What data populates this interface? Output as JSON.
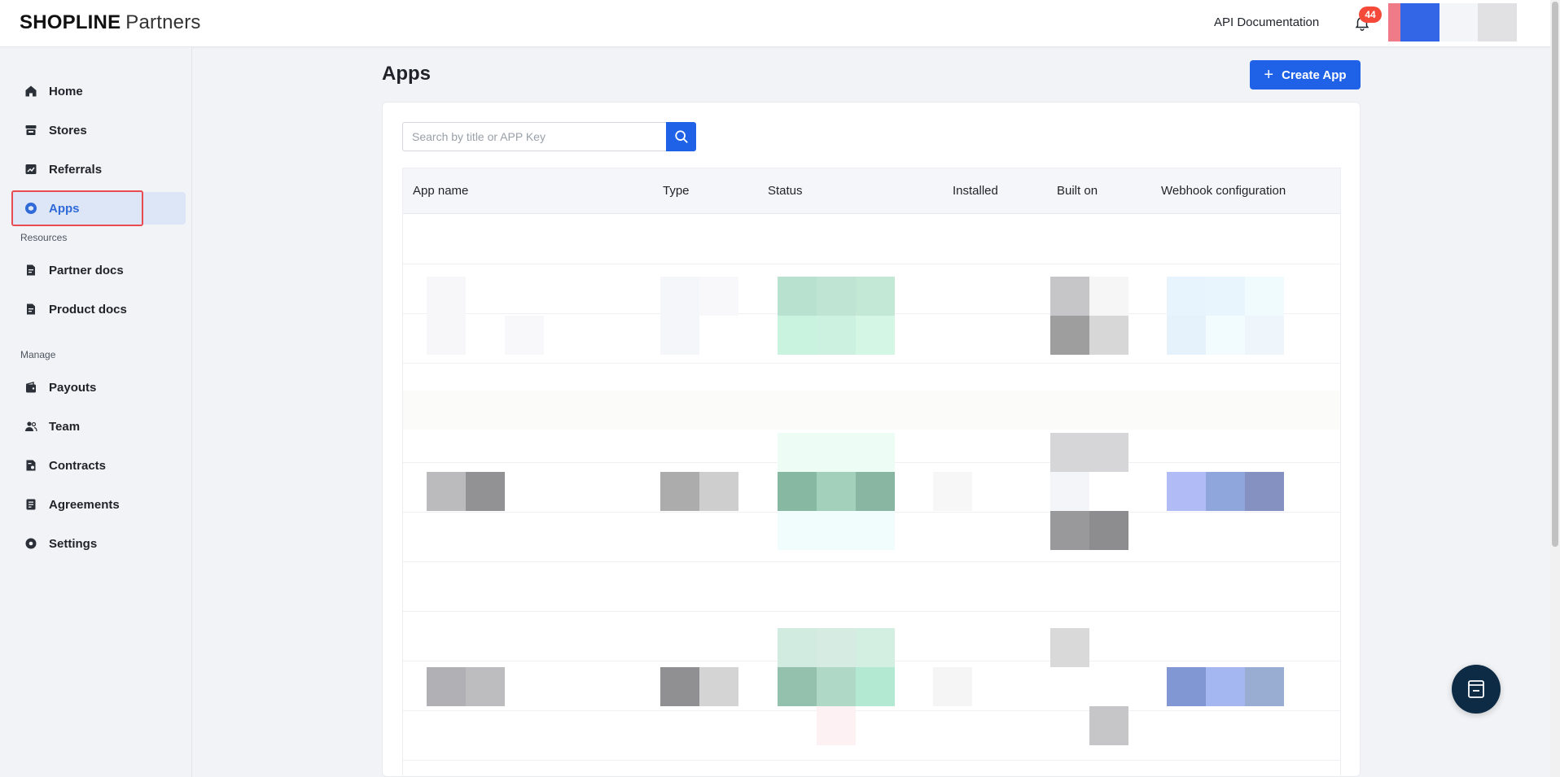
{
  "header": {
    "brand": "SHOPLINE",
    "brand_sub": "Partners",
    "api_doc_label": "API Documentation",
    "notification_count": "44"
  },
  "sidebar": {
    "items": [
      {
        "label": "Home",
        "icon": "home-icon"
      },
      {
        "label": "Stores",
        "icon": "store-icon"
      },
      {
        "label": "Referrals",
        "icon": "chart-icon"
      },
      {
        "label": "Apps",
        "icon": "apps-icon",
        "active": true
      }
    ],
    "resources_label": "Resources",
    "resources": [
      {
        "label": "Partner docs",
        "icon": "document-icon"
      },
      {
        "label": "Product docs",
        "icon": "document-icon"
      }
    ],
    "manage_label": "Manage",
    "manage": [
      {
        "label": "Payouts",
        "icon": "wallet-icon"
      },
      {
        "label": "Team",
        "icon": "team-icon"
      },
      {
        "label": "Contracts",
        "icon": "contract-icon"
      },
      {
        "label": "Agreements",
        "icon": "agreement-icon"
      },
      {
        "label": "Settings",
        "icon": "gear-icon"
      }
    ]
  },
  "main": {
    "title": "Apps",
    "create_label": "Create App",
    "search_placeholder": "Search by title or APP Key",
    "search_value": "",
    "columns": [
      "App name",
      "Type",
      "Status",
      "Installed",
      "Built on",
      "Webhook configuration"
    ]
  },
  "colors": {
    "accent": "#1f62e8",
    "badge": "#f5493a",
    "active_bg": "#dce6f7",
    "highlight_border": "#e94b51"
  }
}
